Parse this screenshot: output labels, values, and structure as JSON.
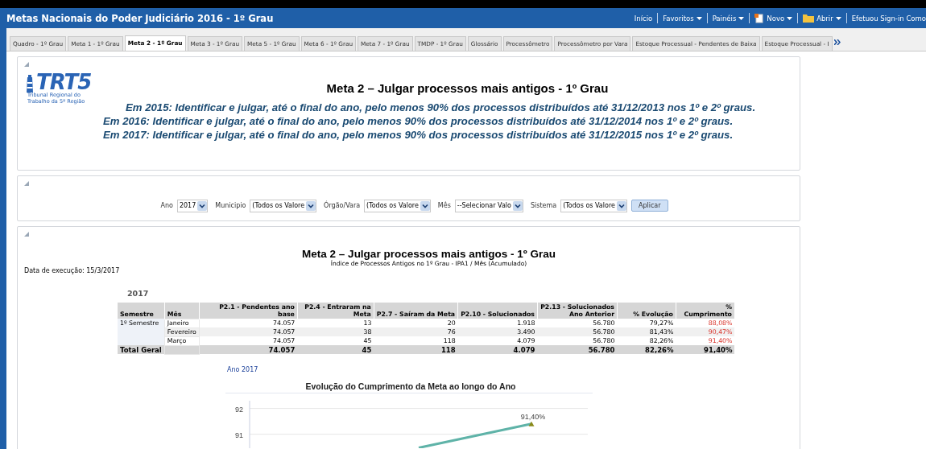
{
  "header": {
    "title": "Metas Nacionais do Poder Judiciário 2016 - 1º Grau",
    "links": [
      {
        "label": "Início",
        "kind": "plain"
      },
      {
        "label": "Favoritos",
        "kind": "menu"
      },
      {
        "label": "Painéis",
        "kind": "menu"
      },
      {
        "label": "Novo",
        "kind": "new"
      },
      {
        "label": "Abrir",
        "kind": "open"
      },
      {
        "label": "Efetuou Sign-in Como",
        "kind": "plain"
      }
    ]
  },
  "tabs": [
    {
      "label": "Quadro - 1º Grau",
      "selected": false
    },
    {
      "label": "Meta 1 - 1º Grau",
      "selected": false
    },
    {
      "label": "Meta 2 - 1º Grau",
      "selected": true
    },
    {
      "label": "Meta 3 - 1º Grau",
      "selected": false
    },
    {
      "label": "Meta 5 - 1º Grau",
      "selected": false
    },
    {
      "label": "Meta 6 - 1º Grau",
      "selected": false
    },
    {
      "label": "Meta 7 - 1º Grau",
      "selected": false
    },
    {
      "label": "TMDP - 1º Grau",
      "selected": false
    },
    {
      "label": "Glossário",
      "selected": false
    },
    {
      "label": "Processômetro",
      "selected": false
    },
    {
      "label": "Processômetro por Vara",
      "selected": false
    },
    {
      "label": "Estoque Processual - Pendentes de Baixa",
      "selected": false
    },
    {
      "label": "Estoque Processual - I",
      "selected": false
    }
  ],
  "intro": {
    "logo": {
      "mark": "TRT5",
      "caption": "Tribunal Regional do Trabalho da 5ª Região"
    },
    "title": "Meta 2 – Julgar processos mais antigos - 1º Grau",
    "goals": [
      "Em 2015: Identificar e julgar, até o final do ano, pelo menos 90% dos processos distribuídos até 31/12/2013 nos 1º e 2º graus.",
      "Em 2016: Identificar e julgar, até o final do ano, pelo menos 90% dos processos distribuídos até 31/12/2014 nos 1º e 2º graus.",
      "Em 2017: Identificar e julgar, até o final do ano, pelo menos 90% dos processos distribuídos até 31/12/2015 nos 1º e 2º graus."
    ]
  },
  "filters": {
    "fields": [
      {
        "label": "Ano",
        "value": "2017"
      },
      {
        "label": "Municipio",
        "value": "(Todos os Valore"
      },
      {
        "label": "Órgão/Vara",
        "value": "(Todos os Valore"
      },
      {
        "label": "Mês",
        "value": "--Selecionar Valo"
      },
      {
        "label": "Sistema",
        "value": "(Todos os Valore"
      }
    ],
    "button": "Aplicar"
  },
  "report": {
    "title": "Meta 2 – Julgar processos mais antigos - 1º Grau",
    "subtitle": "Índice de Processos Antigos no 1º Grau - IPA1 / Mês (Acumulado)",
    "run_date": "Data de execução: 15/3/2017",
    "year": "2017",
    "table": {
      "columns": [
        "Semestre",
        "Mês",
        "P2.1 - Pendentes ano base",
        "P2.4 - Entraram na Meta",
        "P2.7 - Saíram da Meta",
        "P2.10 - Solucionados",
        "P2.13 - Solucionados Ano Anterior",
        "% Evolução",
        "% Cumprimento"
      ],
      "rows": [
        {
          "kind": "detail",
          "alert": true,
          "cells": [
            "1º Semestre",
            "Janeiro",
            "74.057",
            "13",
            "20",
            "1.918",
            "56.780",
            "79,27%",
            "88,08%"
          ]
        },
        {
          "kind": "detail",
          "alert": true,
          "cells": [
            "",
            "Fevereiro",
            "74.057",
            "38",
            "76",
            "3.490",
            "56.780",
            "81,43%",
            "90,47%"
          ]
        },
        {
          "kind": "detail",
          "alert": true,
          "cells": [
            "",
            "Março",
            "74.057",
            "45",
            "118",
            "4.079",
            "56.780",
            "82,26%",
            "91,40%"
          ]
        },
        {
          "kind": "total",
          "alert": false,
          "cells": [
            "Total Geral",
            "",
            "74.057",
            "45",
            "118",
            "4.079",
            "56.780",
            "82,26%",
            "91,40%"
          ]
        }
      ]
    },
    "year_link": "Ano 2017",
    "chart_data": {
      "type": "line",
      "title": "Evolução do Cumprimento da Meta ao longo do Ano",
      "yticks": [
        91,
        92
      ],
      "ylim": [
        90.45,
        92.3
      ],
      "series": [
        {
          "color": "#5fb3a8",
          "values": [
            null,
            90.47,
            91.4
          ]
        }
      ],
      "annotations": [
        "91,40%"
      ]
    }
  }
}
